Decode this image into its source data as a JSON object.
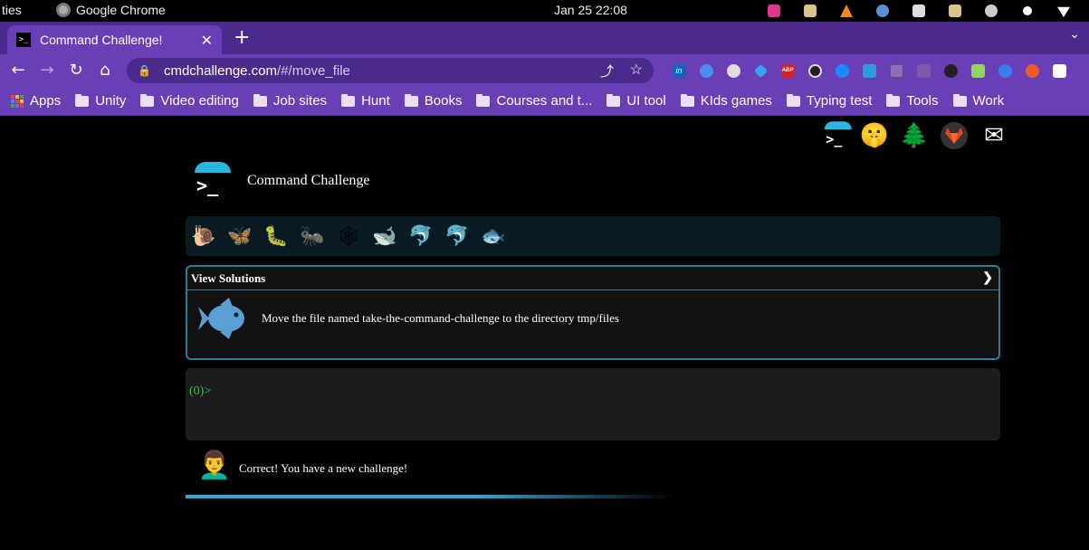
{
  "os": {
    "activities": "ties",
    "app_name": "Google Chrome",
    "clock": "Jan 25  22:08"
  },
  "tab": {
    "title": "Command Challenge!",
    "close": "✕",
    "new_tab": "+",
    "menu": "⌄"
  },
  "toolbar": {
    "back": "←",
    "forward": "→",
    "reload": "↻",
    "home": "⌂",
    "url_host": "cmdchallenge.com",
    "url_path": "/#/move_file",
    "share": "⤴",
    "star": "☆"
  },
  "extensions": [
    "linkedin-icon",
    "drop-icon",
    "globe-icon",
    "diamond-icon",
    "abp-icon",
    "loop-icon",
    "shazam-icon",
    "reader-icon",
    "box-icon",
    "pen-icon",
    "pirate-icon",
    "image-icon",
    "wifi-icon",
    "fire-icon",
    "puzzle-icon"
  ],
  "extension_labels": {
    "abp": "ABP",
    "linkedin": "in"
  },
  "bookmarks": [
    {
      "label": "Apps",
      "type": "apps"
    },
    {
      "label": "Unity",
      "type": "folder"
    },
    {
      "label": "Video editing",
      "type": "folder"
    },
    {
      "label": "Job sites",
      "type": "folder"
    },
    {
      "label": "Hunt",
      "type": "folder"
    },
    {
      "label": "Books",
      "type": "folder"
    },
    {
      "label": "Courses and t...",
      "type": "folder"
    },
    {
      "label": "UI tool",
      "type": "folder"
    },
    {
      "label": "KIds games",
      "type": "folder"
    },
    {
      "label": "Typing test",
      "type": "folder"
    },
    {
      "label": "Tools",
      "type": "folder"
    },
    {
      "label": "Work",
      "type": "folder"
    }
  ],
  "page": {
    "top_icons": [
      "terminal-icon",
      "shush-face-icon",
      "tree-icon",
      "gitlab-icon",
      "mail-icon"
    ],
    "top_icon_glyphs": {
      "shush": "🤫",
      "tree": "🌲",
      "mail": "✉"
    },
    "logo_prompt": ">_",
    "title": "Command Challenge",
    "animals": [
      "🐌",
      "🦋",
      "🐛",
      "🐜",
      "🕸",
      "🐋",
      "🐬",
      "🐬",
      "🐟"
    ],
    "challenge": {
      "header": "View Solutions",
      "chevron": "❯",
      "description": "Move the file named take-the-command-challenge to the directory tmp/files"
    },
    "terminal_prompt": "(0)>",
    "feedback_avatar": "👨‍🦱",
    "feedback_message": "Correct! You have a new challenge!"
  },
  "colors": {
    "tab_strip": "#4a2a8a",
    "toolbar": "#6a3fb5",
    "accent": "#2aa7d6",
    "prompt_green": "#2ecc40"
  }
}
